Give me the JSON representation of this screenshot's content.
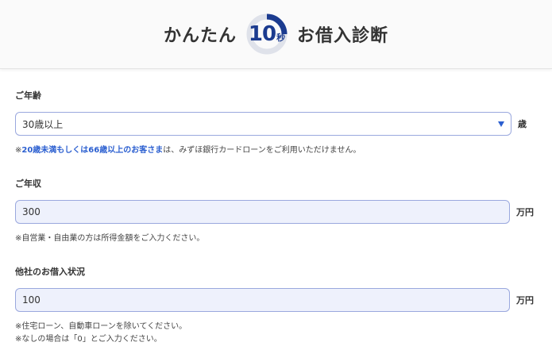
{
  "header": {
    "title_left": "かんたん",
    "timer_number": "10",
    "timer_unit": "秒",
    "title_right": "お借入診断",
    "colors": {
      "accent": "#2b5fd0",
      "timer_ring": "#1b3b8f"
    }
  },
  "age": {
    "label": "ご年齢",
    "selected": "30歳以上",
    "unit": "歳",
    "note_prefix": "※",
    "note_highlight": "20歳未満もしくは66歳以上のお客さま",
    "note_rest": "は、みずほ銀行カードローンをご利用いただけません。"
  },
  "income": {
    "label": "ご年収",
    "value": "300",
    "unit": "万円",
    "note": "※自営業・自由業の方は所得金額をご入力ください。"
  },
  "other_loans": {
    "label": "他社のお借入状況",
    "value": "100",
    "unit": "万円",
    "note1": "※住宅ローン、自動車ローンを除いてください。",
    "note2": "※なしの場合は「0」とご入力ください。"
  }
}
